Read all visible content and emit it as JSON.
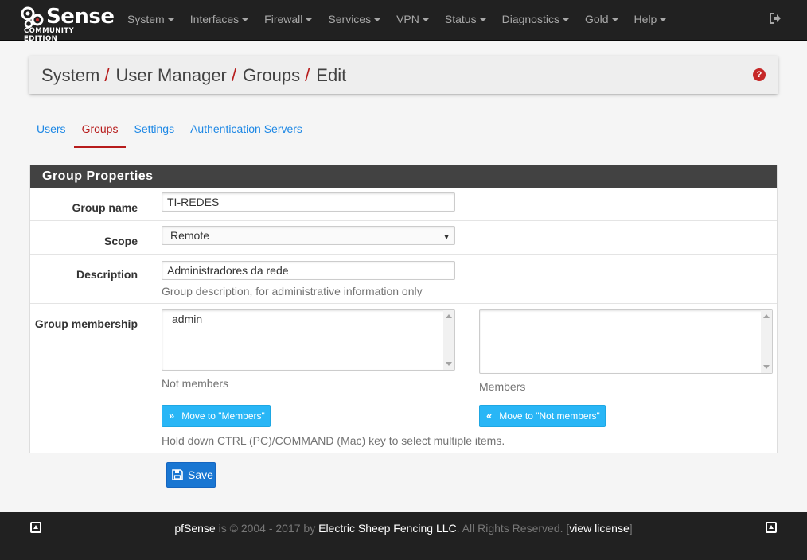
{
  "navbar": {
    "logo_main": "Sense",
    "logo_sub": "COMMUNITY EDITION",
    "menu": [
      "System",
      "Interfaces",
      "Firewall",
      "Services",
      "VPN",
      "Status",
      "Diagnostics",
      "Gold",
      "Help"
    ]
  },
  "breadcrumb": {
    "items": [
      "System",
      "User Manager",
      "Groups",
      "Edit"
    ],
    "separator": "/"
  },
  "tabs": [
    "Users",
    "Groups",
    "Settings",
    "Authentication Servers"
  ],
  "active_tab": "Groups",
  "panel": {
    "title": "Group Properties",
    "group_name": {
      "label": "Group name",
      "value": "TI-REDES"
    },
    "scope": {
      "label": "Scope",
      "value": "Remote"
    },
    "description": {
      "label": "Description",
      "value": "Administradores da rede",
      "help": "Group description, for administrative information only"
    },
    "membership": {
      "label": "Group membership",
      "not_members_items": [
        "admin"
      ],
      "not_members_caption": "Not members",
      "members_items": [],
      "members_caption": "Members"
    },
    "move_to_members": "Move to \"Members\"",
    "move_to_not_members": "Move to \"Not members\"",
    "multi_select_help": "Hold down CTRL (PC)/COMMAND (Mac) key to select multiple items."
  },
  "save_label": "Save",
  "footer": {
    "brand": "pfSense",
    "copyright": " is © 2004 - 2017 by ",
    "company": "Electric Sheep Fencing LLC",
    "rights": ". All Rights Reserved. [",
    "license": "view license",
    "close_bracket": "]"
  },
  "colors": {
    "navbar": "#212121",
    "accent_red": "#b71c1c",
    "link_blue": "#1e88e5",
    "info_button": "#29b6f6",
    "save_button": "#1976d2"
  }
}
